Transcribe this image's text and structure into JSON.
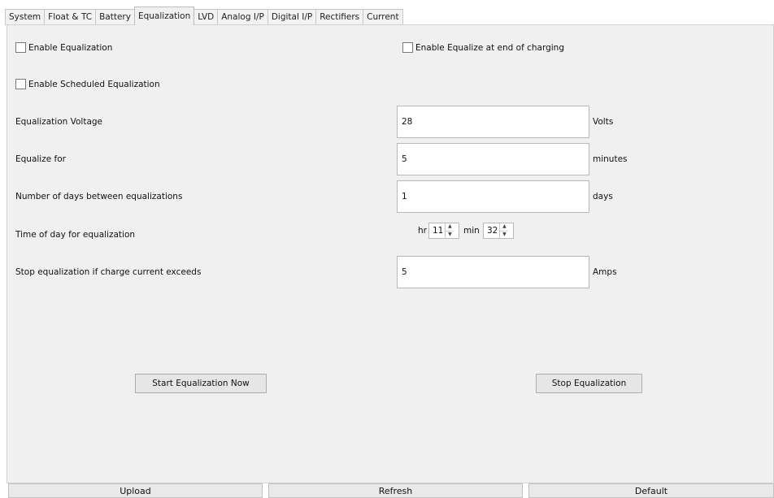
{
  "tabs": [
    {
      "label": "System",
      "active": false
    },
    {
      "label": "Float & TC",
      "active": false
    },
    {
      "label": "Battery",
      "active": false
    },
    {
      "label": "Equalization",
      "active": true
    },
    {
      "label": "LVD",
      "active": false
    },
    {
      "label": "Analog I/P",
      "active": false
    },
    {
      "label": "Digital I/P",
      "active": false
    },
    {
      "label": "Rectifiers",
      "active": false
    },
    {
      "label": "Current",
      "active": false
    }
  ],
  "checkboxes": {
    "enable_equalization": {
      "label": "Enable Equalization",
      "checked": false
    },
    "enable_equalize_end": {
      "label": "Enable Equalize at end of charging",
      "checked": false
    },
    "enable_scheduled": {
      "label": "Enable Scheduled Equalization",
      "checked": false
    }
  },
  "fields": {
    "voltage": {
      "label": "Equalization Voltage",
      "value": "28",
      "unit": "Volts"
    },
    "duration": {
      "label": "Equalize for",
      "value": "5",
      "unit": "minutes"
    },
    "days_between": {
      "label": "Number of days between equalizations",
      "value": "1",
      "unit": "days"
    },
    "time_of_day": {
      "label": "Time of day for equalization",
      "hr_label": "hr",
      "hr_value": "11",
      "min_label": "min",
      "min_value": "32"
    },
    "stop_current": {
      "label": "Stop equalization if charge current exceeds",
      "value": "5",
      "unit": "Amps"
    }
  },
  "buttons": {
    "start": "Start Equalization Now",
    "stop": "Stop Equalization",
    "upload": "Upload",
    "refresh": "Refresh",
    "default": "Default"
  },
  "spinner_glyphs": {
    "up": "▲",
    "down": "▼"
  }
}
